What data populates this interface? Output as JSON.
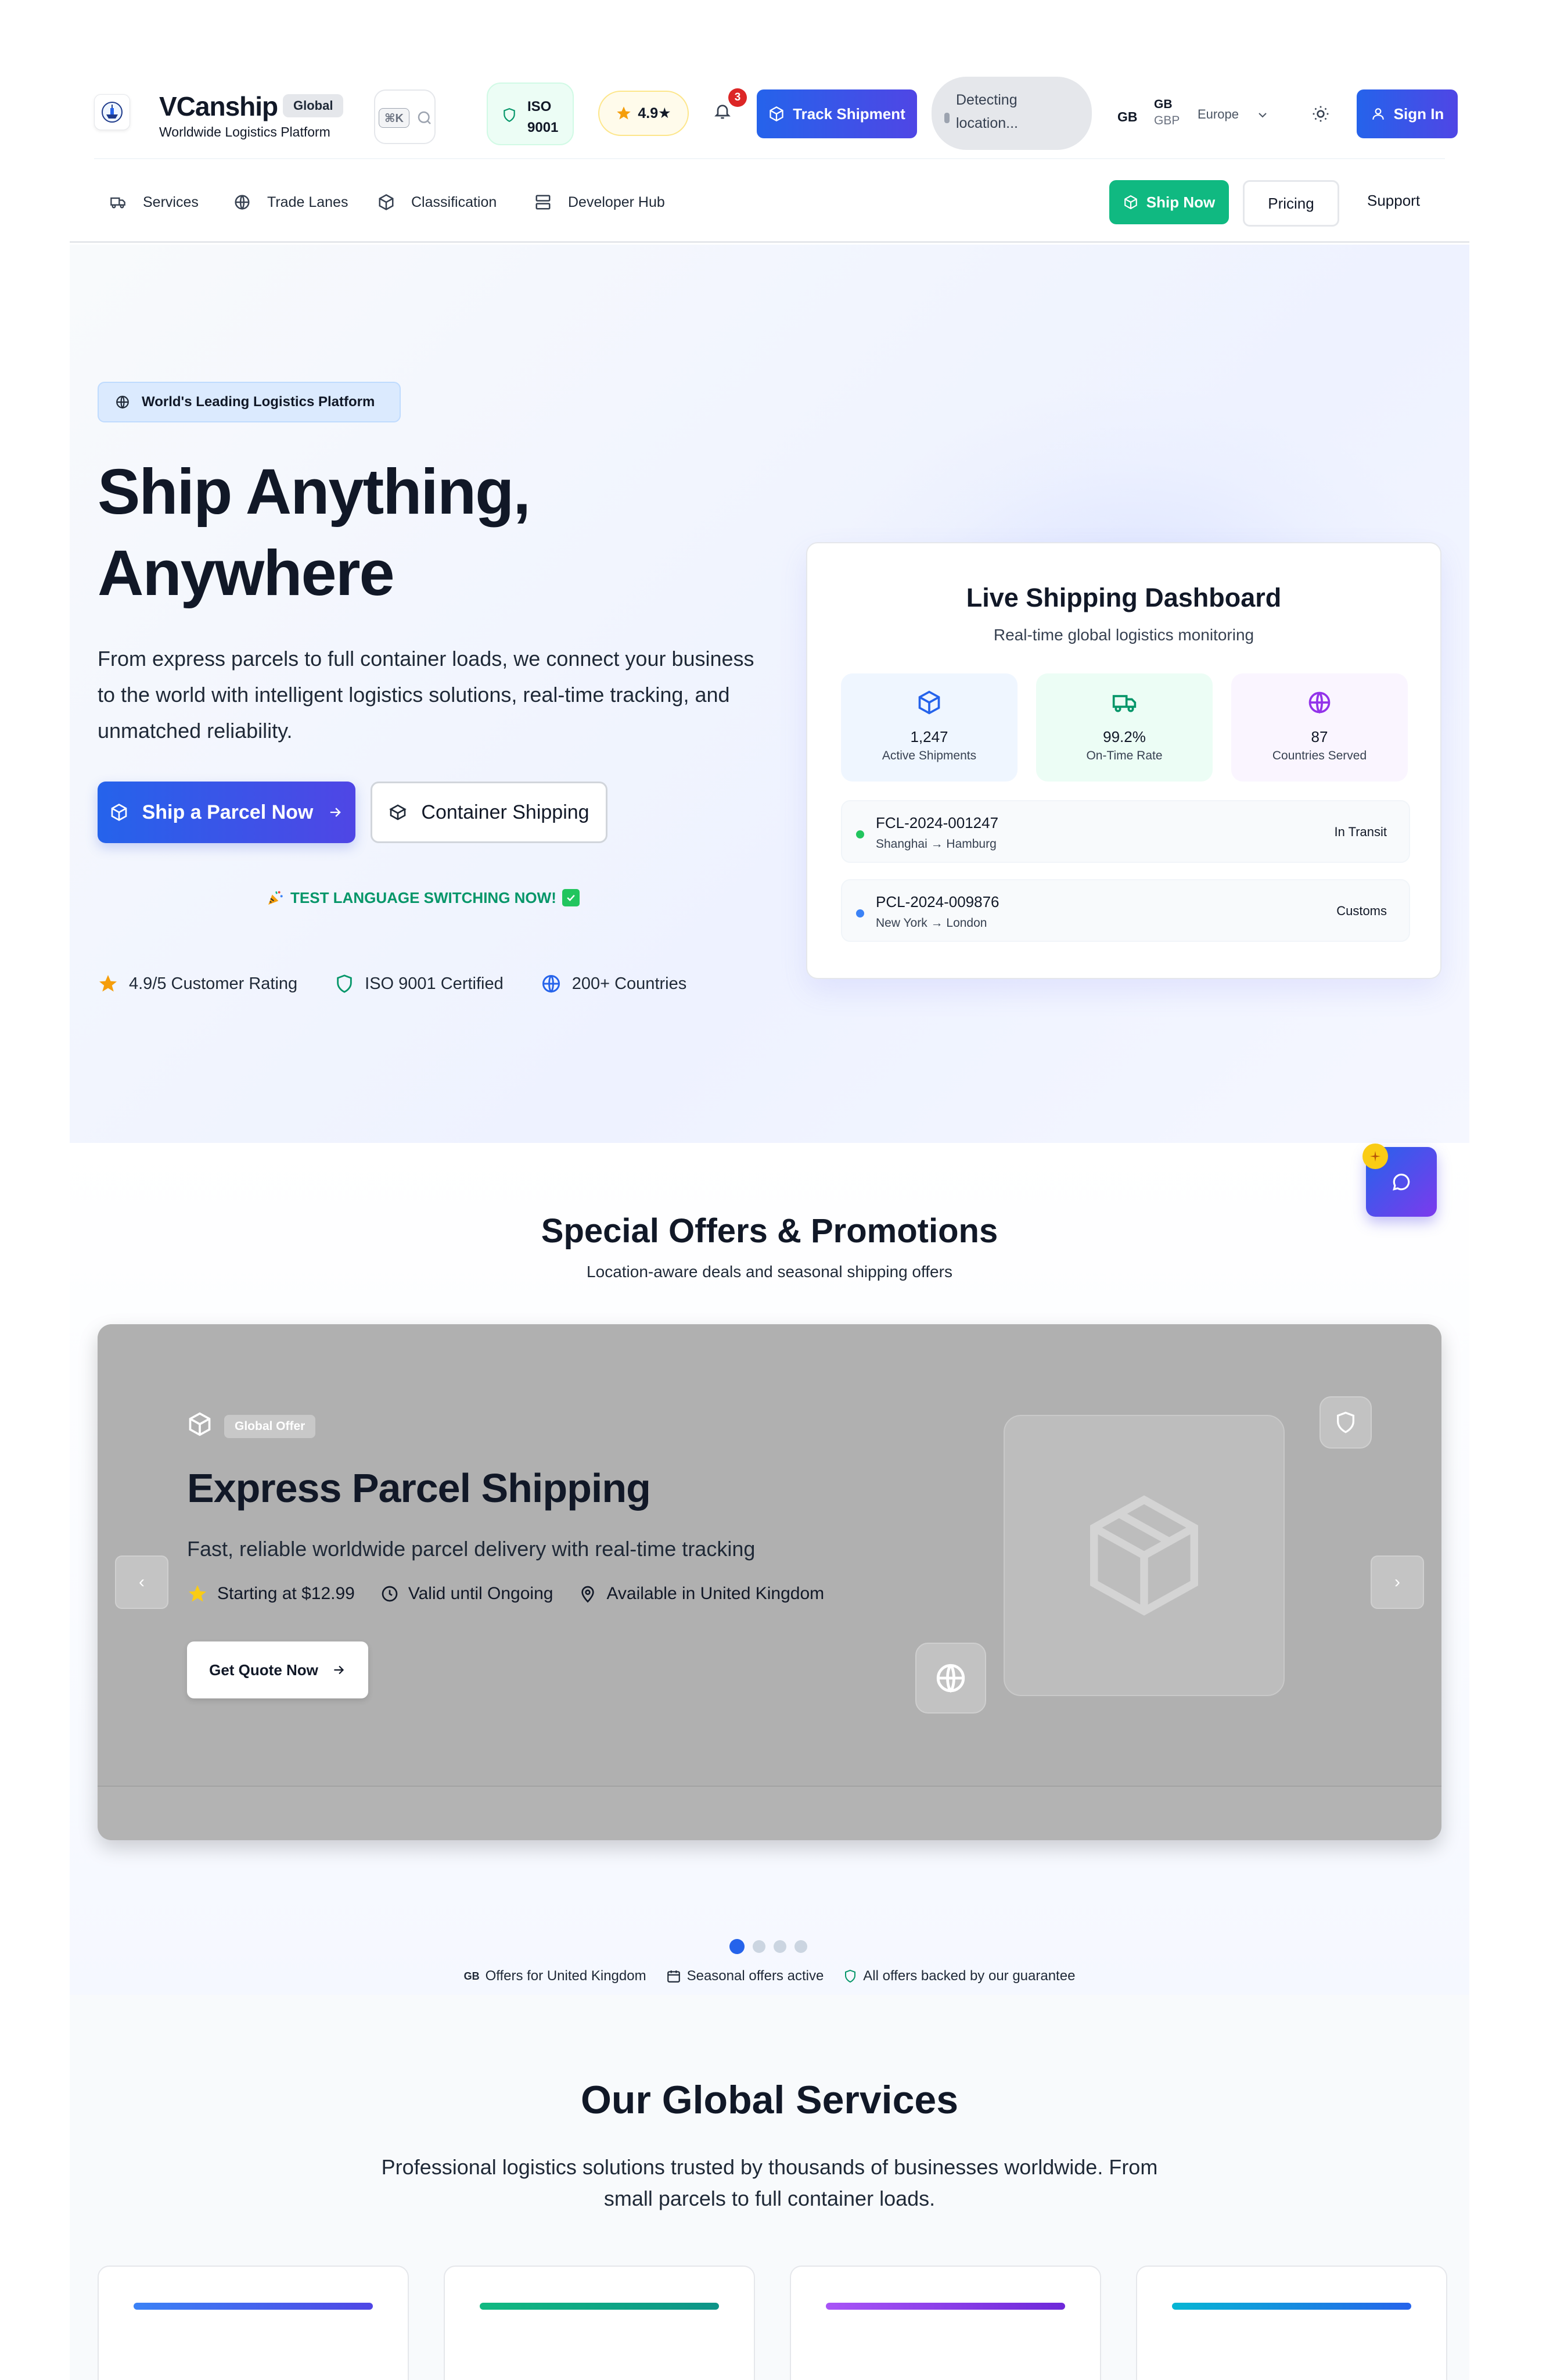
{
  "header": {
    "brand_name": "VCanship",
    "brand_badge": "Global",
    "brand_subtitle": "Worldwide Logistics Platform",
    "search_shortcut": "⌘K",
    "iso_label": "ISO\n9001",
    "rating": "4.9★",
    "notifications_count": "3",
    "track_label": "Track Shipment",
    "location_status": "Detecting\nlocation...",
    "language_code": "GB",
    "currency_flag": "GB",
    "currency_code": "GBP",
    "region": "Europe",
    "signin_label": "Sign In"
  },
  "nav": {
    "items": [
      {
        "label": "Services",
        "icon": "truck-icon"
      },
      {
        "label": "Trade Lanes",
        "icon": "globe-icon"
      },
      {
        "label": "Classification",
        "icon": "box-icon"
      },
      {
        "label": "Developer Hub",
        "icon": "server-icon"
      }
    ],
    "ship_now": "Ship Now",
    "pricing": "Pricing",
    "support": "Support"
  },
  "hero": {
    "badge": "World's Leading Logistics Platform",
    "title": "Ship Anything,\nAnywhere",
    "description": "From express parcels to full container loads, we connect your business to the world with intelligent logistics solutions, real-time tracking, and unmatched reliability.",
    "primary_cta": "Ship a Parcel Now",
    "secondary_cta": "Container Shipping",
    "test_banner": "TEST LANGUAGE SWITCHING NOW!",
    "trust": [
      {
        "label": "4.9/5 Customer Rating",
        "icon": "star-icon"
      },
      {
        "label": "ISO 9001 Certified",
        "icon": "shield-icon"
      },
      {
        "label": "200+ Countries",
        "icon": "globe-icon"
      }
    ]
  },
  "dashboard": {
    "title": "Live Shipping Dashboard",
    "subtitle": "Real-time global logistics monitoring",
    "stats": [
      {
        "value": "1,247",
        "label": "Active Shipments",
        "icon": "box-icon",
        "color": "#2563eb"
      },
      {
        "value": "99.2%",
        "label": "On-Time Rate",
        "icon": "truck-icon",
        "color": "#059669"
      },
      {
        "value": "87",
        "label": "Countries Served",
        "icon": "globe-icon",
        "color": "#9333ea"
      }
    ],
    "shipments": [
      {
        "id": "FCL-2024-001247",
        "route": "Shanghai → Hamburg",
        "status": "In Transit",
        "color": "#22c55e"
      },
      {
        "id": "PCL-2024-009876",
        "route": "New York → London",
        "status": "Customs",
        "color": "#3b82f6"
      }
    ]
  },
  "offers": {
    "title": "Special Offers & Promotions",
    "subtitle": "Location-aware deals and seasonal shipping offers",
    "slide": {
      "badge": "Global Offer",
      "title": "Express Parcel Shipping",
      "description": "Fast, reliable worldwide parcel delivery with real-time tracking",
      "price": "Starting at $12.99",
      "validity": "Valid until Ongoing",
      "availability": "Available in United Kingdom",
      "cta": "Get Quote Now"
    },
    "prev": "‹",
    "next": "›",
    "slide_count": 4,
    "active_slide": 1,
    "footer_flag": "GB",
    "footer_region": "Offers for United Kingdom",
    "footer_seasonal": "Seasonal offers active",
    "footer_guarantee": "All offers backed by our guarantee"
  },
  "services": {
    "title": "Our Global Services",
    "subtitle": "Professional logistics solutions trusted by thousands of businesses worldwide. From small parcels to full container loads.",
    "card_accents": [
      [
        "#3b82f6",
        "#4f46e5"
      ],
      [
        "#10b981",
        "#0d9488"
      ],
      [
        "#a855f7",
        "#6d28d9"
      ],
      [
        "#06b6d4",
        "#2563eb"
      ]
    ]
  },
  "colors": {
    "primary": "#2563eb",
    "success": "#10b981",
    "accent_purple": "#9333ea",
    "star": "#f59e0b"
  }
}
